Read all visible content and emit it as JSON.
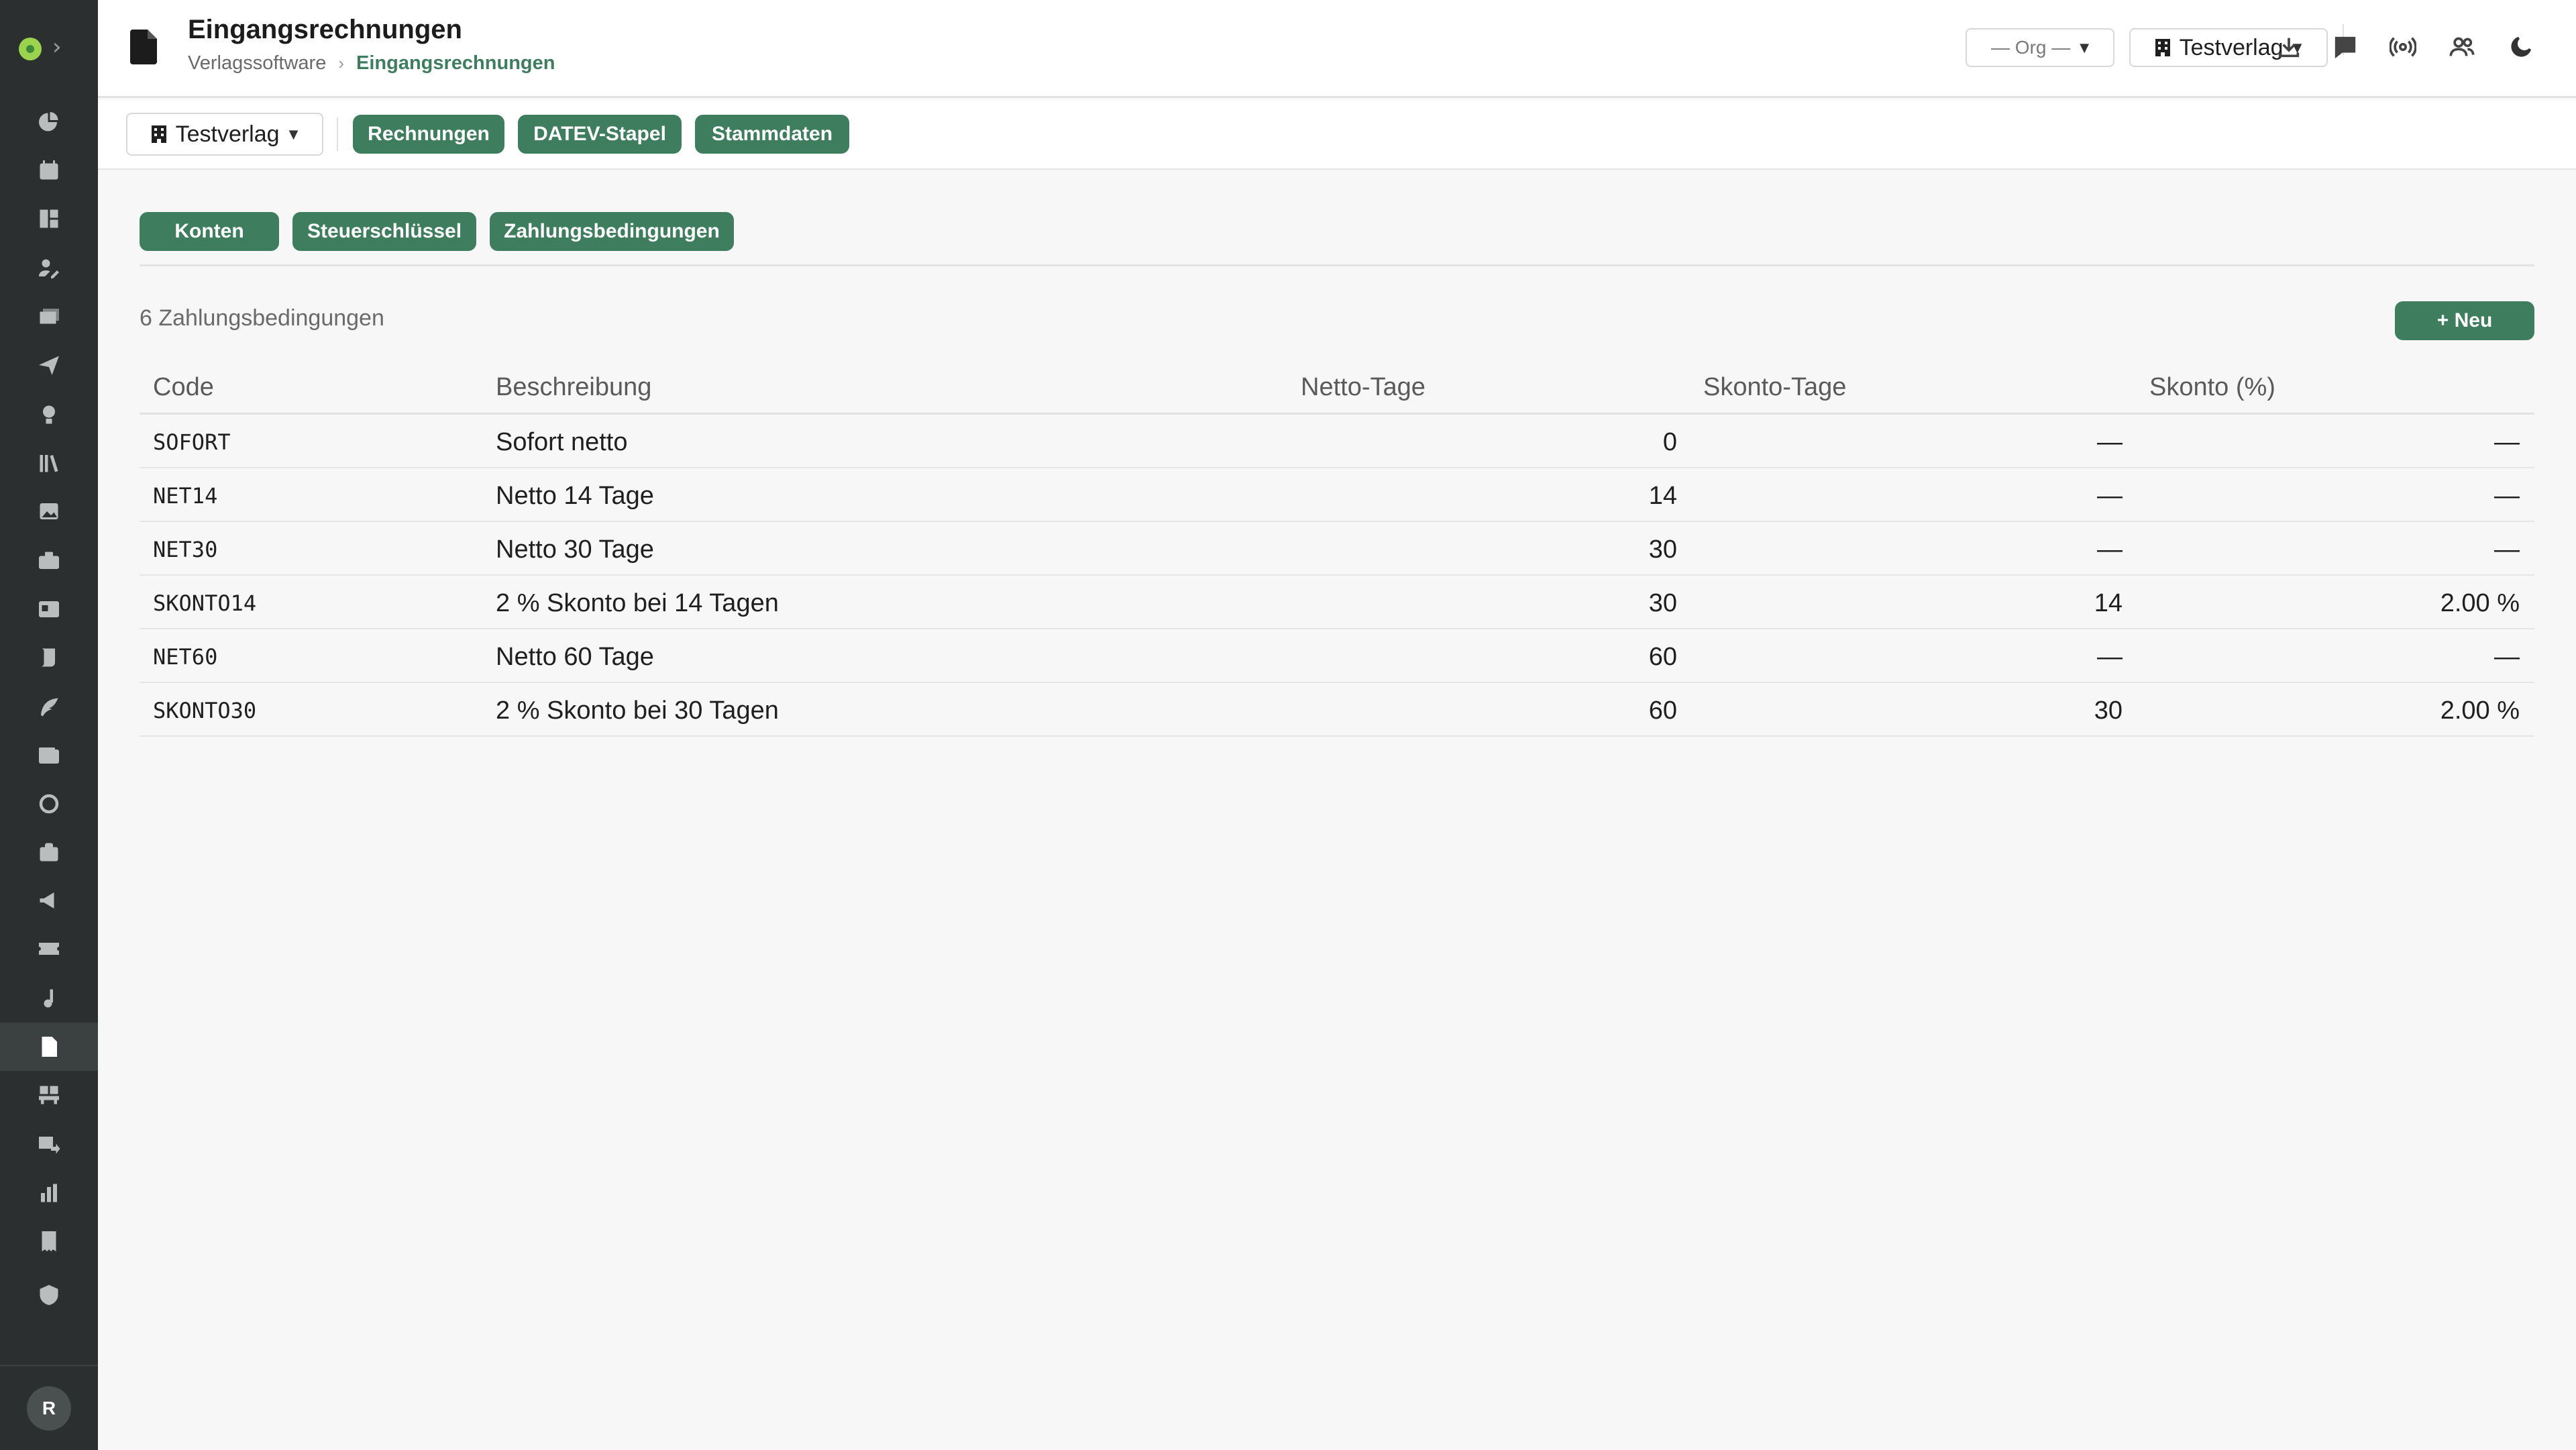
{
  "header": {
    "title": "Eingangsrechnungen",
    "breadcrumb": {
      "root": "Verlagssoftware",
      "separator": "›",
      "current": "Eingangsrechnungen"
    },
    "org_select": "— Org —",
    "publisher_select": "Testverlag"
  },
  "toolbar": {
    "publisher_select": "Testverlag",
    "tabs": [
      "Rechnungen",
      "DATEV-Stapel",
      "Stammdaten"
    ]
  },
  "subtabs": [
    "Konten",
    "Steuerschlüssel",
    "Zahlungsbedingungen"
  ],
  "section": {
    "count_label": "6 Zahlungsbedingungen",
    "new_button": "+ Neu"
  },
  "table": {
    "columns": [
      "Code",
      "Beschreibung",
      "Netto-Tage",
      "Skonto-Tage",
      "Skonto (%)"
    ],
    "rows": [
      {
        "code": "SOFORT",
        "desc": "Sofort netto",
        "netto": "0",
        "skonto_tage": "—",
        "skonto_pct": "—"
      },
      {
        "code": "NET14",
        "desc": "Netto 14 Tage",
        "netto": "14",
        "skonto_tage": "—",
        "skonto_pct": "—"
      },
      {
        "code": "NET30",
        "desc": "Netto 30 Tage",
        "netto": "30",
        "skonto_tage": "—",
        "skonto_pct": "—"
      },
      {
        "code": "SKONTO14",
        "desc": "2 % Skonto bei 14 Tagen",
        "netto": "30",
        "skonto_tage": "14",
        "skonto_pct": "2.00 %"
      },
      {
        "code": "NET60",
        "desc": "Netto 60 Tage",
        "netto": "60",
        "skonto_tage": "—",
        "skonto_pct": "—"
      },
      {
        "code": "SKONTO30",
        "desc": "2 % Skonto bei 30 Tagen",
        "netto": "60",
        "skonto_tage": "30",
        "skonto_pct": "2.00 %"
      }
    ]
  },
  "sidebar": {
    "avatar_initial": "R",
    "icons": [
      "pie-chart-icon",
      "calendar-icon",
      "dashboard-icon",
      "user-edit-icon",
      "mail-stack-icon",
      "send-icon",
      "lightbulb-icon",
      "library-icon",
      "image-icon",
      "briefcase-icon",
      "contact-card-icon",
      "scroll-icon",
      "feather-icon",
      "wallet-icon",
      "circle-icon",
      "bag-icon",
      "megaphone-icon",
      "ticket-icon",
      "music-icon",
      "invoice-icon",
      "warehouse-icon",
      "transfer-icon",
      "bar-chart-icon",
      "receipt-icon",
      "shield-icon"
    ],
    "active_icon": "invoice-icon"
  },
  "colors": {
    "accent": "#3f7d5f",
    "sidebar": "#2b2f2f",
    "background": "#f7f7f7"
  }
}
